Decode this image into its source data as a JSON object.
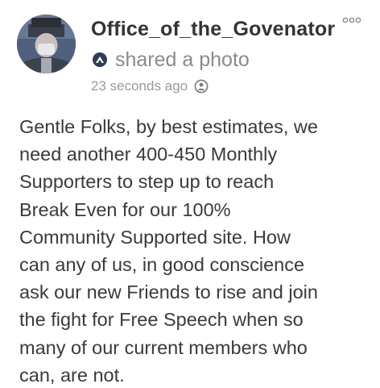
{
  "post": {
    "author": "Office_of_the_Govenator",
    "action": "shared a photo",
    "timestamp": "23 seconds ago",
    "body_lines": [
      "Gentle Folks, by best estimates, we",
      "need another 400-450 Monthly",
      "Supporters to step up to reach",
      "Break Even for our 100%",
      "Community Supported site. How",
      "can any of us, in good conscience",
      "ask our new Friends to rise and join",
      "the fight for Free Speech when so",
      "many of our current members who",
      "can, are not."
    ]
  },
  "icons": {
    "avatar": "user-avatar",
    "more": "more-options-icon",
    "badge": "member-badge-icon",
    "privacy": "public-privacy-icon"
  },
  "colors": {
    "author_text": "#333333",
    "secondary_text": "#8a8a8a",
    "body_text": "#3a3a3a",
    "badge_bg": "#2e3d55"
  }
}
